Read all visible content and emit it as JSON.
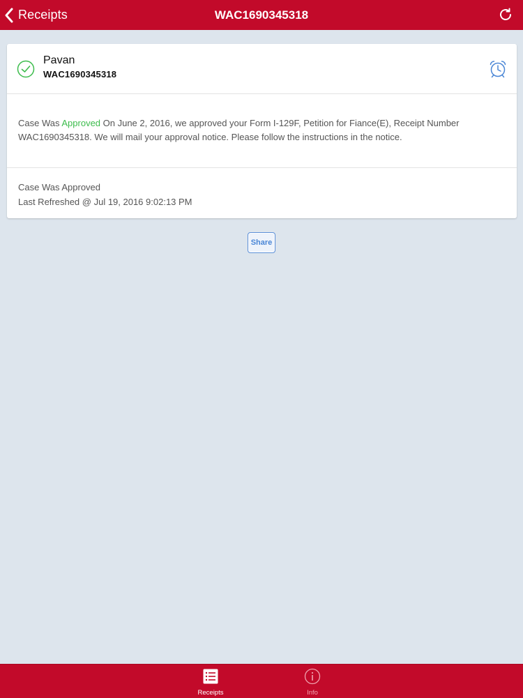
{
  "colors": {
    "brand_red": "#c20a2a",
    "background": "#dde5ed",
    "approved_green": "#3cbc4c",
    "link_blue": "#4a86d6"
  },
  "navbar": {
    "back_label": "Receipts",
    "title": "WAC1690345318",
    "back_icon": "chevron-left-icon",
    "refresh_icon": "refresh-icon"
  },
  "case": {
    "status_icon": "check-circle-icon",
    "alarm_icon": "alarm-clock-icon",
    "name": "Pavan",
    "receipt_number": "WAC1690345318",
    "message": {
      "prefix": "Case Was ",
      "status_word": "Approved",
      "body": " On June 2, 2016, we approved your Form I-129F, Petition for Fiance(E), Receipt Number WAC1690345318. We will mail your approval notice. Please follow the instructions in the notice."
    },
    "status_line": "Case Was Approved",
    "last_refreshed": "Last Refreshed @ Jul 19, 2016 9:02:13 PM"
  },
  "share": {
    "label": "Share"
  },
  "tabbar": {
    "tabs": [
      {
        "label": "Receipts",
        "icon": "list-icon",
        "selected": true
      },
      {
        "label": "Info",
        "icon": "info-icon",
        "selected": false
      }
    ]
  }
}
